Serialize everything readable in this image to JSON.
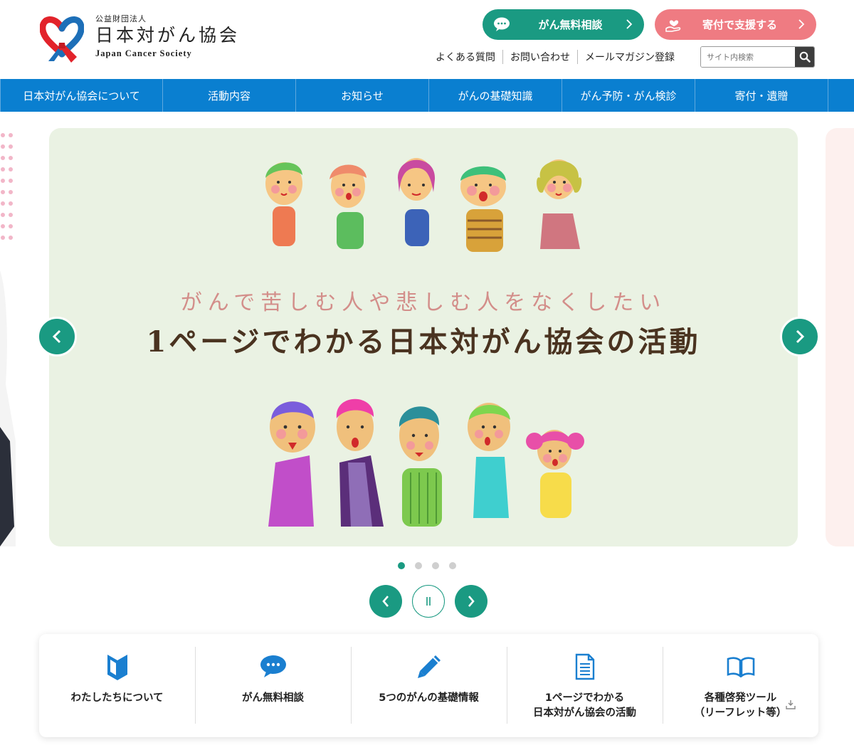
{
  "header": {
    "logo_sub": "公益財団法人",
    "logo_main": "日本対がん協会",
    "logo_en": "Japan Cancer Society",
    "cta_consult": "がん無料相談",
    "cta_donate": "寄付で支援する",
    "sublinks": [
      "よくある質問",
      "お問い合わせ",
      "メールマガジン登録"
    ],
    "search_placeholder": "サイト内検索"
  },
  "nav": {
    "items": [
      "日本対がん協会について",
      "活動内容",
      "お知らせ",
      "がんの基礎知識",
      "がん予防・がん検診",
      "寄付・遺贈"
    ]
  },
  "slide": {
    "subtitle": "がんで苦しむ人や悲しむ人をなくしたい",
    "title": "1ページでわかる日本対がん協会の活動",
    "total_slides": 4,
    "active_slide": 1
  },
  "quick_links": [
    {
      "line1": "わたしたちについて",
      "line2": "",
      "icon": "beginner-mark-icon"
    },
    {
      "line1": "がん無料相談",
      "line2": "",
      "icon": "chat-bubble-icon"
    },
    {
      "line1": "5つのがんの基礎情報",
      "line2": "",
      "icon": "pencil-icon"
    },
    {
      "line1": "1ページでわかる",
      "line2": "日本対がん協会の活動",
      "icon": "document-icon"
    },
    {
      "line1": "各種啓発ツール",
      "line2": "（リーフレット等）",
      "icon": "open-book-icon"
    }
  ],
  "colors": {
    "nav_blue": "#0a7fd0",
    "brand_green": "#1a9a82",
    "donate_pink": "#ef7b82",
    "slide_bg": "#eaf2e3"
  }
}
